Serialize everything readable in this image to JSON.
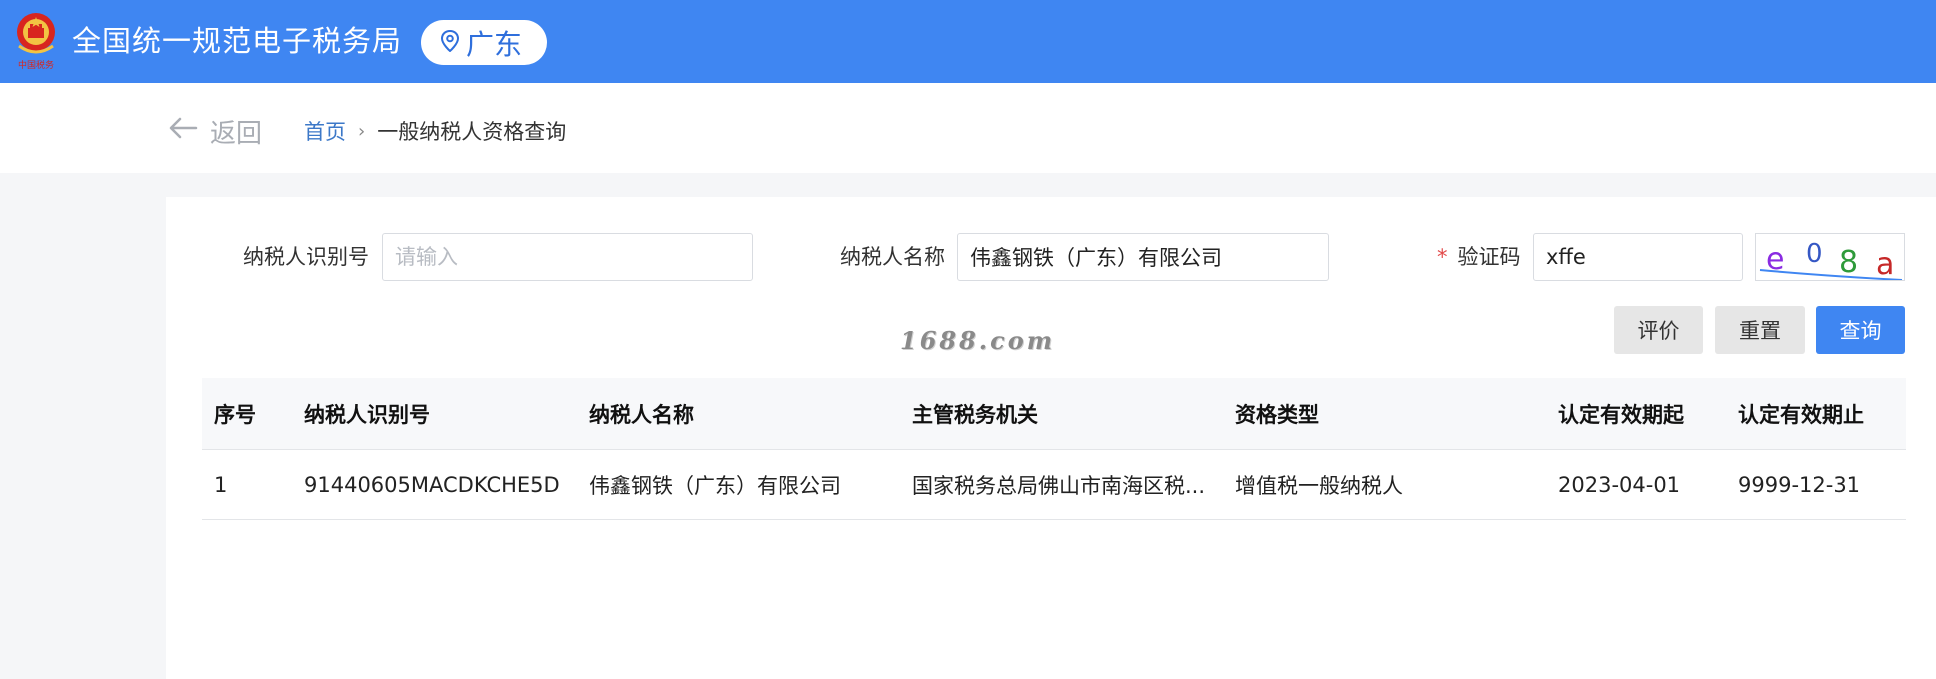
{
  "header": {
    "emblem_caption": "中国税务",
    "title": "全国统一规范电子税务局",
    "region": "广东",
    "bg_color": "#3f86f2"
  },
  "nav": {
    "back_label": "返回",
    "breadcrumb_home": "首页",
    "breadcrumb_separator": "›",
    "breadcrumb_current": "一般纳税人资格查询"
  },
  "form": {
    "taxpayer_id_label": "纳税人识别号",
    "taxpayer_id_value": "",
    "taxpayer_id_placeholder": "请输入",
    "taxpayer_name_label": "纳税人名称",
    "taxpayer_name_value": "伟鑫钢铁（广东）有限公司",
    "captcha_label": "验证码",
    "captcha_required_mark": "*",
    "captcha_value": "xffe",
    "captcha_image_text": "e 0 8 a"
  },
  "buttons": {
    "evaluate": "评价",
    "reset": "重置",
    "query": "查询"
  },
  "watermark": "1688.com",
  "table": {
    "headers": [
      "序号",
      "纳税人识别号",
      "纳税人名称",
      "主管税务机关",
      "资格类型",
      "认定有效期起",
      "认定有效期止"
    ],
    "rows": [
      [
        "1",
        "91440605MACDKCHE5D",
        "伟鑫钢铁（广东）有限公司",
        "国家税务总局佛山市南海区税...",
        "增值税一般纳税人",
        "2023-04-01",
        "9999-12-31"
      ]
    ]
  }
}
